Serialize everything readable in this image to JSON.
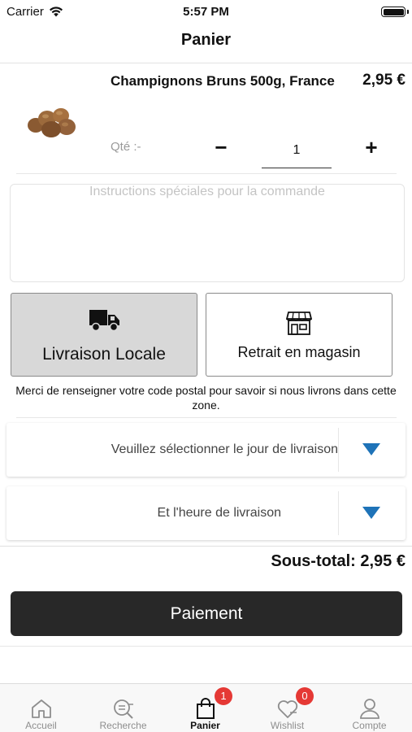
{
  "status_bar": {
    "carrier": "Carrier",
    "time": "5:57 PM"
  },
  "header": {
    "title": "Panier"
  },
  "cart_item": {
    "name": "Champignons Bruns 500g, France",
    "price": "2,95 €",
    "qty_label": "Qté :-",
    "qty_minus": "−",
    "qty_value": "1",
    "qty_plus": "+"
  },
  "instructions": {
    "placeholder": "Instructions spéciales pour la commande"
  },
  "delivery_options": {
    "local_delivery_label": "Livraison Locale",
    "store_pickup_label": "Retrait en magasin",
    "postal_note": "Merci de renseigner votre code postal pour savoir si nous livrons dans cette zone."
  },
  "delivery_day": {
    "placeholder": "Veuillez sélectionner le jour de livraison"
  },
  "delivery_hour": {
    "placeholder": "Et l'heure de livraison"
  },
  "summary": {
    "subtotal": "Sous-total: 2,95 €",
    "pay_label": "Paiement"
  },
  "tab_bar": {
    "tabs": [
      {
        "label": "Accueil",
        "icon": "home-icon"
      },
      {
        "label": "Recherche",
        "icon": "search-icon"
      },
      {
        "label": "Panier",
        "icon": "bag-icon",
        "badge": "1"
      },
      {
        "label": "Wishlist",
        "icon": "heart-icon",
        "badge": "0"
      },
      {
        "label": "Compte",
        "icon": "user-icon"
      }
    ]
  },
  "colors": {
    "accent_arrow": "#1e73b8",
    "badge": "#e53935",
    "pay_button": "#282828",
    "selected_option": "#d8d8d8"
  }
}
